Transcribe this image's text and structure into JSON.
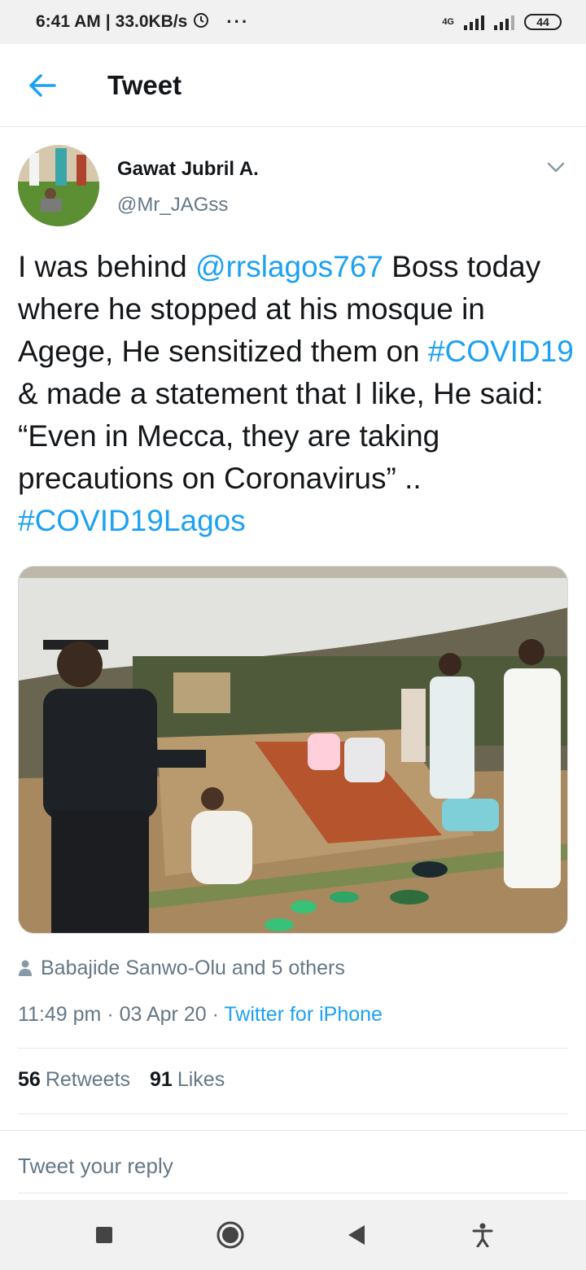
{
  "status_bar": {
    "time": "6:41 AM",
    "speed": "33.0KB/s",
    "more": "···",
    "network": "4G",
    "battery": "44"
  },
  "header": {
    "title": "Tweet"
  },
  "tweet": {
    "author_name": "Gawat Jubril A.",
    "author_handle": "@Mr_JAGss",
    "text_parts": {
      "t1": "I was behind ",
      "mention": "@rrslagos767",
      "t2": " Boss today where he stopped at his mosque in Agege, He sensitized them on ",
      "hashtag1": "#COVID19",
      "t3": " & made a statement that I like, He said: “Even in Mecca, they are taking precautions on Coronavirus” .. ",
      "hashtag2": "#COVID19Lagos"
    },
    "liked_by": "Babajide Sanwo-Olu and 5 others",
    "time": "11:49 pm · 03 Apr 20 · ",
    "source": "Twitter for iPhone",
    "retweets_count": "56",
    "retweets_label": "Retweets",
    "likes_count": "91",
    "likes_label": "Likes"
  },
  "reply": {
    "placeholder": "Tweet your reply"
  },
  "colors": {
    "accent": "#1da1f2",
    "secondary_text": "#657786",
    "primary_text": "#14171a"
  }
}
